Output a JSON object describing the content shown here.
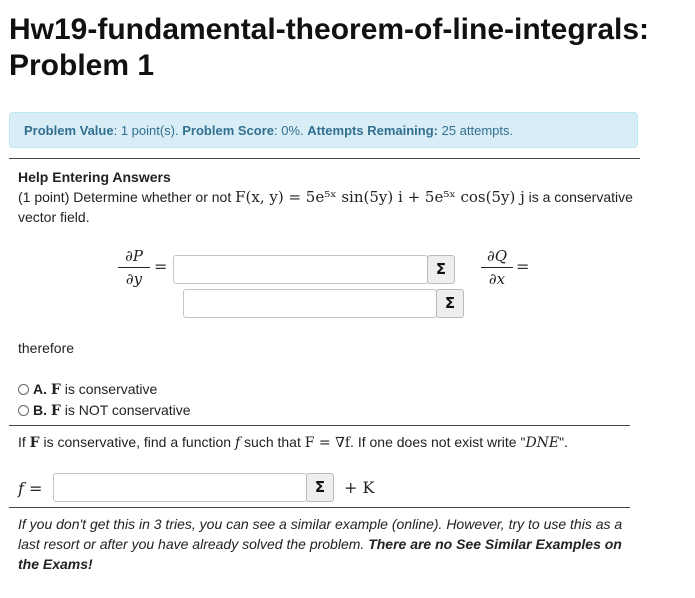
{
  "title_line1": "Hw19-fundamental-theorem-of-line-integrals:",
  "title_line2": "Problem 1",
  "info": {
    "value_label": "Problem Value",
    "value_text": ": 1 point(s). ",
    "score_label": "Problem Score",
    "score_text": ": 0%. ",
    "attempts_label": "Attempts Remaining:",
    "attempts_text": " 25 attempts."
  },
  "help_label": "Help Entering Answers",
  "prompt": {
    "prefix": "(1 point) Determine whether or not ",
    "expr": "F(x, y) = 5e⁵ˣ sin(5y) i + 5e⁵ˣ cos(5y) j",
    "suffix": " is a conservative",
    "line2": "vector field."
  },
  "partials": {
    "p_num": "∂P",
    "p_den": "∂y",
    "q_num": "∂Q",
    "q_den": "∂x",
    "equals": "="
  },
  "sigma_label": "Σ",
  "therefore": "therefore",
  "options": [
    {
      "letter": "A.",
      "var": "F",
      "text": " is conservative"
    },
    {
      "letter": "B.",
      "var": "F",
      "text": " is NOT conservative"
    }
  ],
  "find": {
    "p1": "If ",
    "F": "F",
    "p2": " is conservative, find a function ",
    "f": "f",
    "p3": " such that ",
    "eq": "F = ∇f",
    "p4": ". If one does not exist write \"",
    "dne": "DNE",
    "p5": "\"."
  },
  "f_label": "f =",
  "plus_k": "+ K",
  "note": {
    "italic": "If you don't get this in 3 tries, you can see a similar example (online). However, try to use this as a last resort or after you have already solved the problem. ",
    "bold": "There are no See Similar Examples on the Exams!"
  }
}
